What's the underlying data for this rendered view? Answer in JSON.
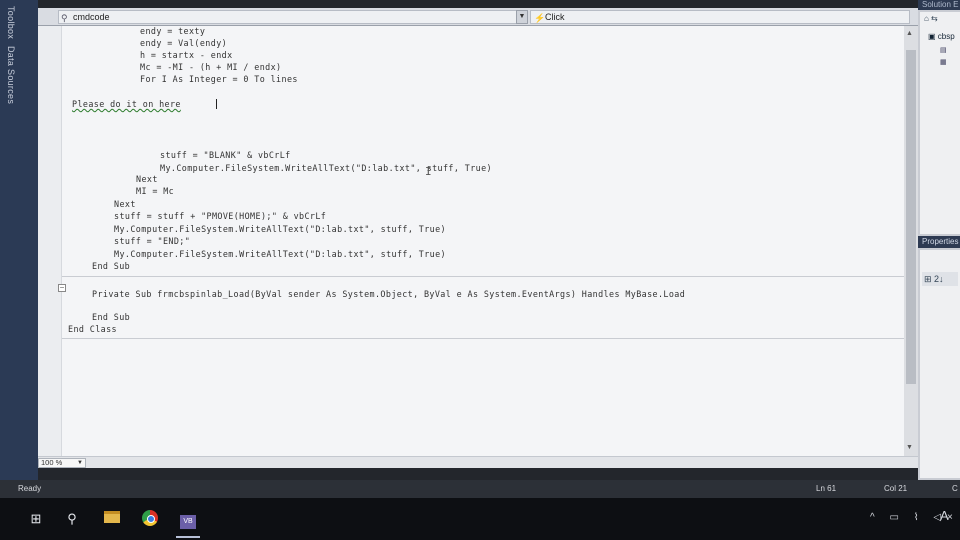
{
  "left_strip": {
    "toolbox": "Toolbox",
    "datasources": "Data Sources"
  },
  "dropdowns": {
    "class_name": "cmdcode",
    "method_name": "Click"
  },
  "code": {
    "lines": [
      "endy = texty",
      "endy = Val(endy)",
      "h = startx - endx",
      "Mc = -MI - (h + MI / endx)",
      "For I As Integer = 0 To lines",
      "Please do it on here",
      "stuff = \"BLANK\" & vbCrLf",
      "My.Computer.FileSystem.WriteAllText(\"D:lab.txt\", stuff, True)",
      "Next",
      "MI = Mc",
      "Next",
      "stuff = stuff + \"PMOVE(HOME);\" & vbCrLf",
      "My.Computer.FileSystem.WriteAllText(\"D:lab.txt\", stuff, True)",
      "stuff = \"END;\"",
      "My.Computer.FileSystem.WriteAllText(\"D:lab.txt\", stuff, True)",
      "End Sub",
      "Private Sub frmcbspinlab_Load(ByVal sender As System.Object, ByVal e As System.EventArgs) Handles MyBase.Load",
      "End Sub",
      "End Class"
    ]
  },
  "zoom": {
    "value": "100 %"
  },
  "right_panel": {
    "solution_header": "Solution E",
    "solution_item": "cbsp",
    "properties_header": "Properties",
    "props_toolbar": "⊞ 2↓"
  },
  "status_bar": {
    "ready": "Ready",
    "line": "Ln 61",
    "column": "Col 21",
    "ch": "C"
  },
  "taskbar": {
    "vs_label": "VB",
    "tray_text": "^ ▭ ⌇ ◁×"
  }
}
